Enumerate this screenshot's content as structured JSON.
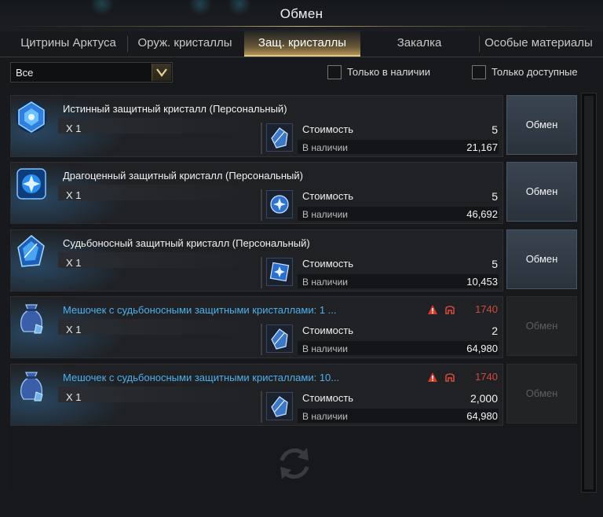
{
  "header": {
    "title": "Обмен"
  },
  "tabs": [
    {
      "label": "Цитрины Арктуса"
    },
    {
      "label": "Оруж. кристаллы"
    },
    {
      "label": "Защ. кристаллы"
    },
    {
      "label": "Закалка"
    },
    {
      "label": "Особые материалы"
    }
  ],
  "active_tab_index": 2,
  "filters": {
    "dropdown_value": "Все",
    "only_in_stock": "Только в наличии",
    "only_available": "Только доступные"
  },
  "labels": {
    "cost": "Стоимость",
    "in_stock": "В наличии",
    "exchange": "Обмен"
  },
  "items": [
    {
      "name": "Истинный защитный кристалл (Персональный)",
      "qty": "X 1",
      "cost": "5",
      "stock": "21,167",
      "available": true,
      "icon": "true-defense-crystal-icon"
    },
    {
      "name": "Драгоценный защитный кристалл (Персональный)",
      "qty": "X 1",
      "cost": "5",
      "stock": "46,692",
      "available": true,
      "icon": "precious-defense-crystal-icon"
    },
    {
      "name": "Судьбоносный защитный кристалл (Персональный)",
      "qty": "X 1",
      "cost": "5",
      "stock": "10,453",
      "available": true,
      "icon": "fateful-defense-crystal-icon"
    },
    {
      "name": "Мешочек с судьбоносными защитными кристаллами: 1 ...",
      "qty": "X 1",
      "cost": "2",
      "stock": "64,980",
      "available": false,
      "level": "1740",
      "icon": "crystal-pouch-icon"
    },
    {
      "name": "Мешочек с судьбоносными защитными кристаллами: 10...",
      "qty": "X 1",
      "cost": "2,000",
      "stock": "64,980",
      "available": false,
      "level": "1740",
      "icon": "crystal-pouch-icon"
    }
  ],
  "colors": {
    "accent": "#c9b27a",
    "link": "#4fb0ec",
    "warning": "#d04a3a"
  }
}
